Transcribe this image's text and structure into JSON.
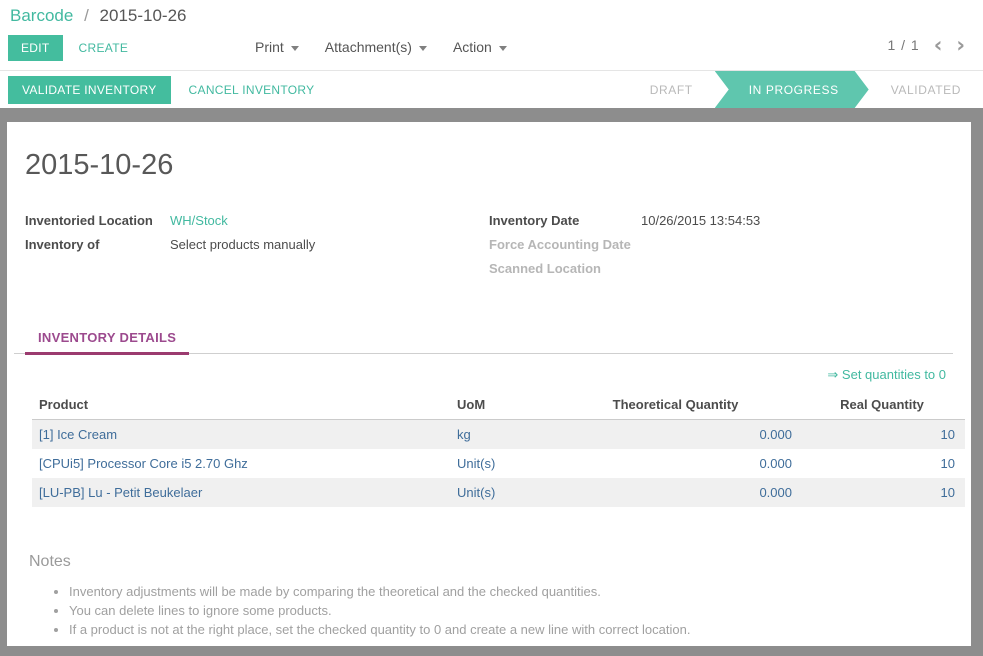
{
  "colors": {
    "brand_teal": "#44bd9e",
    "pipeline_active_teal": "#5fc6ae",
    "tab_purple": "#9c4a8e",
    "tab_underline": "#9b3b6f",
    "cell_blue": "#3f6d9a",
    "frame_gray": "#8d8d8d",
    "row_stripe": "#f0f0f0"
  },
  "topbar": {
    "breadcrumb": {
      "parent": "Barcode",
      "separator": "/",
      "current": "2015-10-26"
    },
    "edit_button": "EDIT",
    "create_button": "CREATE",
    "menus": [
      {
        "label": "Print"
      },
      {
        "label": "Attachment(s)"
      },
      {
        "label": "Action"
      }
    ],
    "pager": {
      "value": "1 / 1",
      "prev": "‹",
      "next": "›"
    }
  },
  "statusbar": {
    "validate_button": "VALIDATE INVENTORY",
    "cancel_button": "CANCEL INVENTORY",
    "states": [
      {
        "label": "DRAFT"
      },
      {
        "label": "IN PROGRESS"
      },
      {
        "label": "VALIDATED"
      }
    ],
    "active_state": "IN PROGRESS"
  },
  "form": {
    "title": "2015-10-26",
    "left_fields": [
      {
        "label": "Inventoried Location",
        "value": "WH/Stock"
      },
      {
        "label": "Inventory of",
        "value": "Select products manually"
      }
    ],
    "right_fields": [
      {
        "label": "Inventory Date",
        "value": "10/26/2015 13:54:53"
      },
      {
        "label": "Force Accounting Date",
        "value": ""
      },
      {
        "label": "Scanned Location",
        "value": ""
      }
    ]
  },
  "notebook": {
    "active_tab": "INVENTORY DETAILS"
  },
  "details": {
    "set_quantities_link": "⇒ Set quantities to 0",
    "table": {
      "headers": [
        "Product",
        "UoM",
        "Theoretical Quantity",
        "Real Quantity"
      ],
      "rows": [
        [
          "[1] Ice Cream",
          "kg",
          "0.000",
          "10"
        ],
        [
          "[CPUi5] Processor Core i5 2.70 Ghz",
          "Unit(s)",
          "0.000",
          "10"
        ],
        [
          "[LU-PB] Lu - Petit Beukelaer",
          "Unit(s)",
          "0.000",
          "10"
        ]
      ]
    }
  },
  "notes": {
    "heading": "Notes",
    "items": [
      "Inventory adjustments will be made by comparing the theoretical and the checked quantities.",
      "You can delete lines to ignore some products.",
      "If a product is not at the right place, set the checked quantity to 0 and create a new line with correct location."
    ]
  }
}
